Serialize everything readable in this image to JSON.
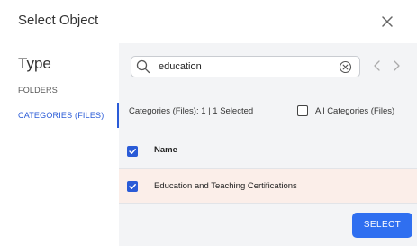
{
  "dialog": {
    "title": "Select Object",
    "close_icon": "close-icon"
  },
  "sidebar": {
    "heading": "Type",
    "items": [
      {
        "label": "FOLDERS",
        "active": false
      },
      {
        "label": "CATEGORIES (FILES)",
        "active": true
      }
    ]
  },
  "search": {
    "value": "education",
    "search_icon": "search-icon",
    "clear_icon": "clear-circle-icon"
  },
  "pagination": {
    "prev_icon": "chevron-left-icon",
    "next_icon": "chevron-right-icon"
  },
  "summary": {
    "count_text": "Categories (Files): 1 | 1 Selected",
    "all_categories_label": "All Categories (Files)",
    "all_categories_checked": false
  },
  "table": {
    "header": {
      "name": "Name",
      "checked": true
    },
    "rows": [
      {
        "name": "Education and Teaching Certifications",
        "checked": true
      }
    ]
  },
  "actions": {
    "select_label": "SELECT"
  },
  "colors": {
    "accent": "#2f6ff0",
    "nav_active": "#2a5bd7",
    "selected_row": "#fbeee9",
    "content_bg": "#f3f4f6"
  }
}
